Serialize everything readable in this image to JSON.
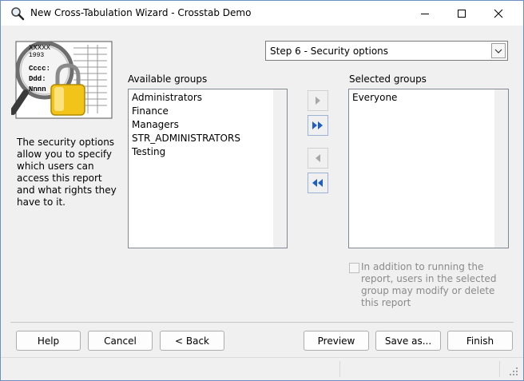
{
  "window": {
    "title": "New Cross-Tabulation Wizard - Crosstab Demo"
  },
  "illustration": {
    "line1": "XXXXX",
    "line2": "1993",
    "line3": "Cccc:",
    "line4": "Ddd:",
    "line5": "Nnnn"
  },
  "description": "The security options allow you to specify which users can access this report and what rights they have to it.",
  "step_select": {
    "value": "Step 6 - Security options"
  },
  "available": {
    "label": "Available groups",
    "items": [
      "Administrators",
      "Finance",
      "Managers",
      "STR_ADMINISTRATORS",
      "Testing"
    ]
  },
  "selected": {
    "label": "Selected groups",
    "items": [
      "Everyone"
    ]
  },
  "options": {
    "modify_label": "In addition to running the report, users in the selected group may modify or delete this report",
    "modify_checked": false
  },
  "buttons": {
    "help": "Help",
    "cancel": "Cancel",
    "back": "< Back",
    "preview": "Preview",
    "save_as": "Save as...",
    "finish": "Finish"
  }
}
